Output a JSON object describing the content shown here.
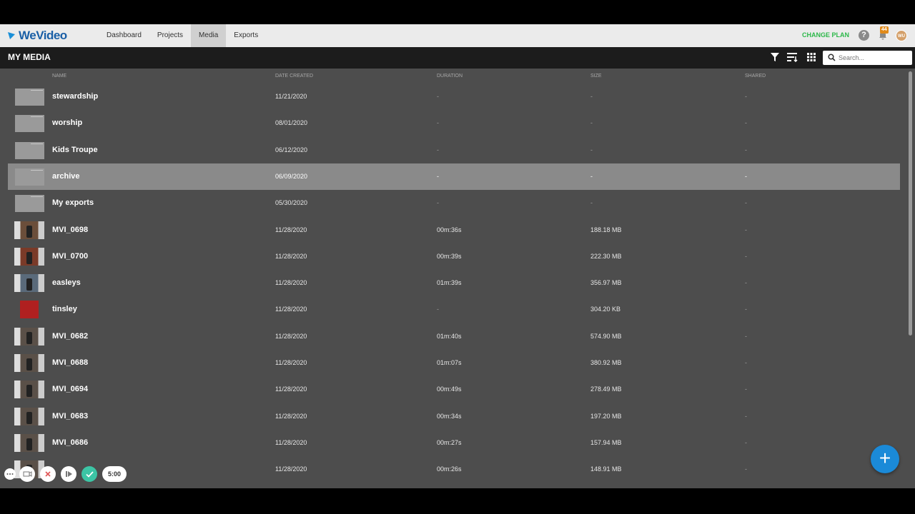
{
  "app": {
    "logo": "WeVideo"
  },
  "nav": [
    {
      "label": "Dashboard",
      "active": false
    },
    {
      "label": "Projects",
      "active": false
    },
    {
      "label": "Media",
      "active": true
    },
    {
      "label": "Exports",
      "active": false
    }
  ],
  "topbar": {
    "change_plan": "CHANGE PLAN",
    "help": "?",
    "notifications": "44",
    "avatar": "WU"
  },
  "header": {
    "title": "MY MEDIA",
    "search_placeholder": "Search..."
  },
  "columns": {
    "name": "NAME",
    "date": "DATE CREATED",
    "duration": "DURATION",
    "size": "SIZE",
    "shared": "SHARED"
  },
  "rows": [
    {
      "name": "stewardship",
      "date": "11/21/2020",
      "duration": "-",
      "size": "-",
      "shared": "-",
      "type": "folder"
    },
    {
      "name": "worship",
      "date": "08/01/2020",
      "duration": "-",
      "size": "-",
      "shared": "-",
      "type": "folder"
    },
    {
      "name": "Kids Troupe",
      "date": "06/12/2020",
      "duration": "-",
      "size": "-",
      "shared": "-",
      "type": "folder"
    },
    {
      "name": "archive",
      "date": "06/09/2020",
      "duration": "-",
      "size": "-",
      "shared": "-",
      "type": "folder"
    },
    {
      "name": "My exports",
      "date": "05/30/2020",
      "duration": "-",
      "size": "-",
      "shared": "-",
      "type": "folder"
    },
    {
      "name": "MVI_0698",
      "date": "11/28/2020",
      "duration": "00m:36s",
      "size": "188.18 MB",
      "shared": "-",
      "type": "video"
    },
    {
      "name": "MVI_0700",
      "date": "11/28/2020",
      "duration": "00m:39s",
      "size": "222.30 MB",
      "shared": "-",
      "type": "video"
    },
    {
      "name": "easleys",
      "date": "11/28/2020",
      "duration": "01m:39s",
      "size": "356.97 MB",
      "shared": "-",
      "type": "video"
    },
    {
      "name": "tinsley",
      "date": "11/28/2020",
      "duration": "-",
      "size": "304.20 KB",
      "shared": "-",
      "type": "image"
    },
    {
      "name": "MVI_0682",
      "date": "11/28/2020",
      "duration": "01m:40s",
      "size": "574.90 MB",
      "shared": "-",
      "type": "video"
    },
    {
      "name": "MVI_0688",
      "date": "11/28/2020",
      "duration": "01m:07s",
      "size": "380.92 MB",
      "shared": "-",
      "type": "video"
    },
    {
      "name": "MVI_0694",
      "date": "11/28/2020",
      "duration": "00m:49s",
      "size": "278.49 MB",
      "shared": "-",
      "type": "video"
    },
    {
      "name": "MVI_0683",
      "date": "11/28/2020",
      "duration": "00m:34s",
      "size": "197.20 MB",
      "shared": "-",
      "type": "video"
    },
    {
      "name": "MVI_0686",
      "date": "11/28/2020",
      "duration": "00m:27s",
      "size": "157.94 MB",
      "shared": "-",
      "type": "video"
    },
    {
      "name": "",
      "date": "11/28/2020",
      "duration": "00m:26s",
      "size": "148.91 MB",
      "shared": "-",
      "type": "video"
    }
  ],
  "selected_row": 3,
  "recorder": {
    "timer": "5:00"
  },
  "fab": {
    "label": "+"
  },
  "colors": {
    "accent": "#1b8ad8",
    "change_plan": "#2db84a",
    "badge": "#e08a1a",
    "selected": "#8a8a8a",
    "background": "#4d4d4d"
  }
}
